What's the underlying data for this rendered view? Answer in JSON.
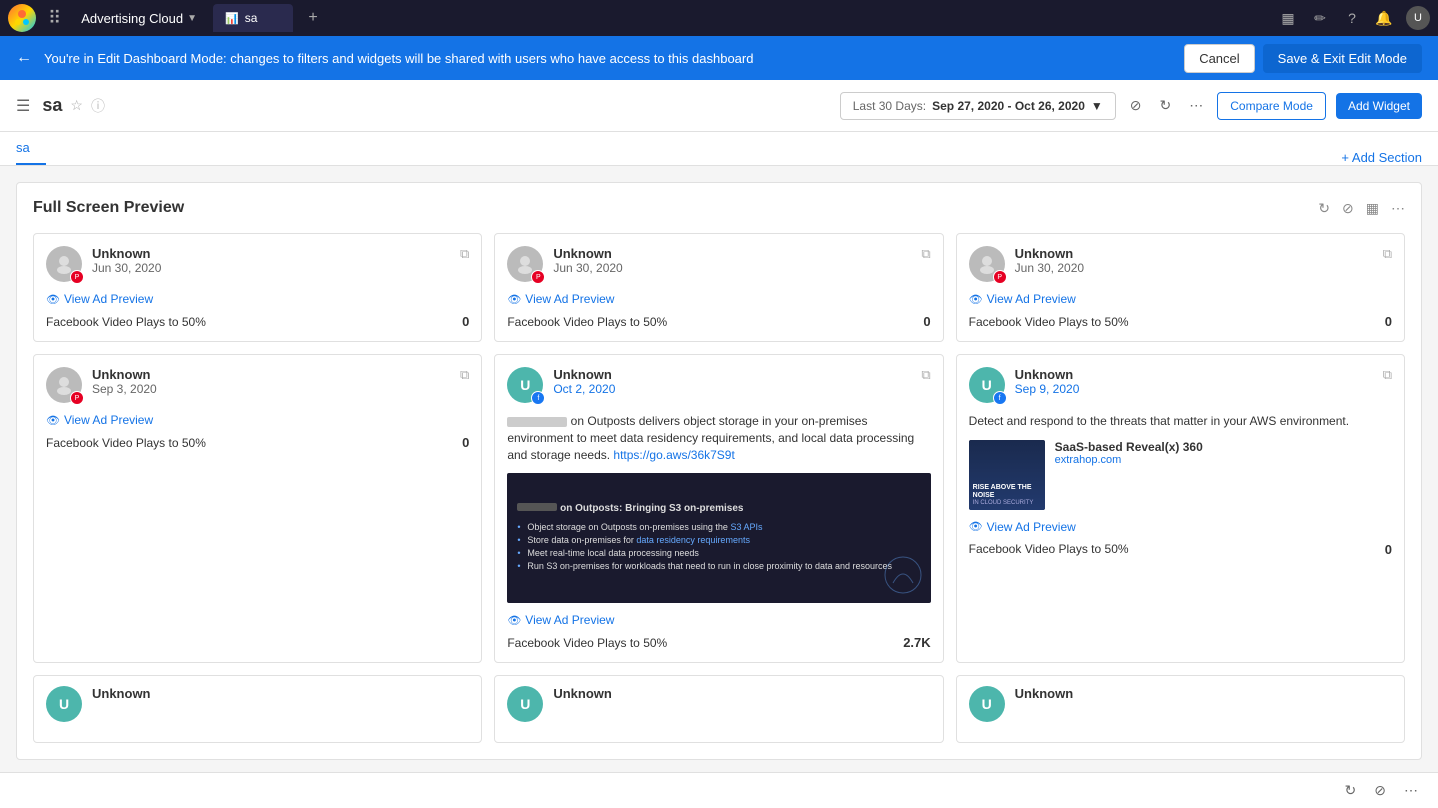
{
  "app": {
    "product": "Advertising Cloud",
    "product_chevron": "▼",
    "tab_label": "sa",
    "tab_icon": "📊"
  },
  "topbar": {
    "icons": [
      "grid",
      "calendar",
      "edit",
      "help",
      "bell",
      "user"
    ],
    "add_tab": "+"
  },
  "edit_bar": {
    "message": "You're in Edit Dashboard Mode: changes to filters and widgets will be shared with users who have access to this dashboard",
    "cancel_label": "Cancel",
    "save_label": "Save & Exit Edit Mode"
  },
  "toolbar": {
    "title": "sa",
    "date_label": "Last 30 Days:",
    "date_range": "Sep 27, 2020 - Oct 26, 2020",
    "compare_label": "Compare Mode",
    "add_widget_label": "Add Widget"
  },
  "tabs": [
    {
      "label": "sa",
      "active": true
    }
  ],
  "add_section_label": "+ Add Section",
  "section": {
    "title": "Full Screen Preview",
    "cards": [
      {
        "username": "Unknown",
        "date": "Jun 30, 2020",
        "avatar_type": "gray",
        "badge": "pinterest",
        "view_ad_label": "View Ad Preview",
        "metric_label": "Facebook Video Plays to 50%",
        "metric_value": "0",
        "content_type": "simple"
      },
      {
        "username": "Unknown",
        "date": "Jun 30, 2020",
        "avatar_type": "gray",
        "badge": "pinterest",
        "view_ad_label": "View Ad Preview",
        "metric_label": "Facebook Video Plays to 50%",
        "metric_value": "0",
        "content_type": "simple"
      },
      {
        "username": "Unknown",
        "date": "Jun 30, 2020",
        "avatar_type": "gray",
        "badge": "pinterest",
        "view_ad_label": "View Ad Preview",
        "metric_label": "Facebook Video Plays to 50%",
        "metric_value": "0",
        "content_type": "simple"
      },
      {
        "username": "Unknown",
        "date": "Sep 3, 2020",
        "avatar_type": "gray",
        "badge": "pinterest",
        "view_ad_label": "View Ad Preview",
        "metric_label": "Facebook Video Plays to 50%",
        "metric_value": "0",
        "content_type": "simple"
      },
      {
        "username": "Unknown",
        "date": "Oct 2, 2020",
        "avatar_type": "teal",
        "badge": "facebook",
        "view_ad_label": "View Ad Preview",
        "metric_label": "Facebook Video Plays to 50%",
        "metric_value": "2.7K",
        "content_type": "rich",
        "post_text": "on Outposts delivers object storage in your on-premises environment to meet data residency requirements, and local data processing and storage needs.",
        "post_link": "https://go.aws/36k7S9t",
        "image_title": " on Outposts: Bringing S3 on-premises",
        "image_bullets": [
          "Object storage on Outposts on-premises using the S3 APIs",
          "Store data on-premises for data residency requirements",
          "Meet real-time local data processing needs",
          "Run S3 on-premises for workloads that need to run in close proximity to data and resources"
        ]
      },
      {
        "username": "Unknown",
        "date": "Sep 9, 2020",
        "avatar_type": "teal",
        "badge": "facebook",
        "view_ad_label": "View Ad Preview",
        "metric_label": "Facebook Video Plays to 50%",
        "metric_value": "0",
        "content_type": "extrahop",
        "post_text": "Detect and respond to the threats that matter in your AWS environment.",
        "extrahop_headline": "SaaS-based Reveal(x) 360",
        "extrahop_domain": "extrahop.com"
      }
    ],
    "bottom_cards": [
      {
        "username": "Unknown",
        "avatar_type": "teal"
      },
      {
        "username": "Unknown",
        "avatar_type": "teal"
      },
      {
        "username": "Unknown",
        "avatar_type": "teal"
      }
    ]
  }
}
